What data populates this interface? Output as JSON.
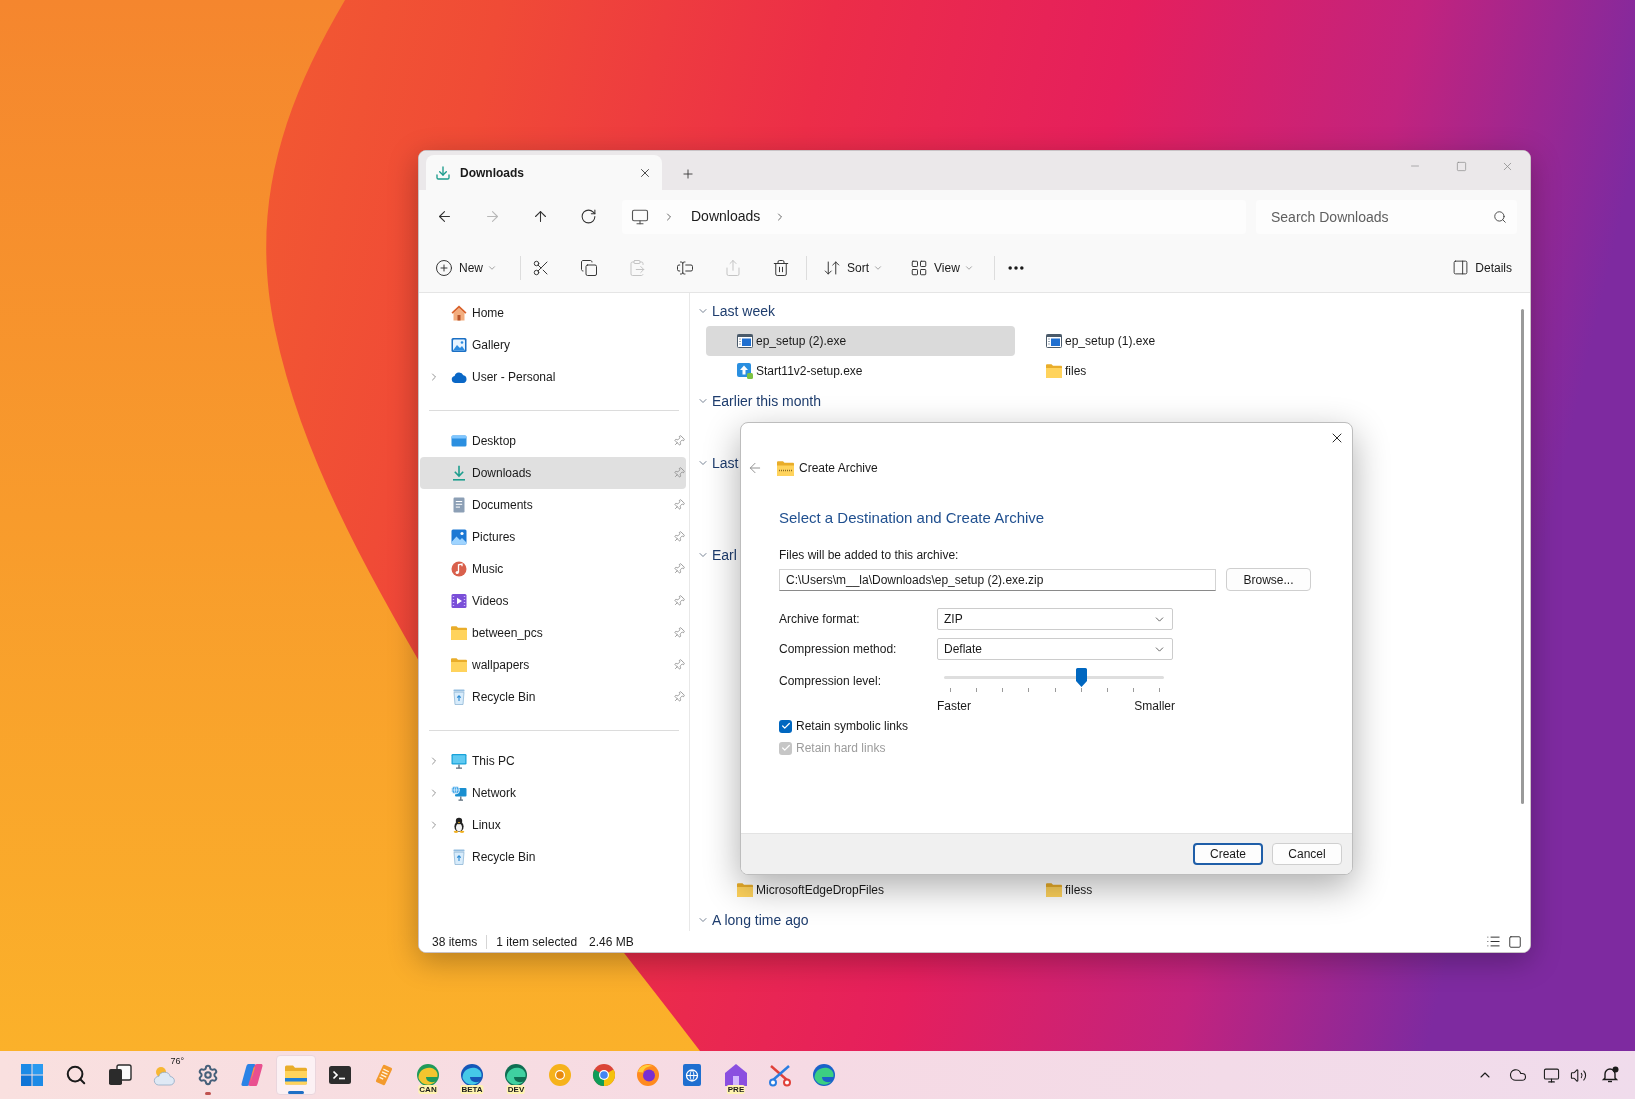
{
  "window": {
    "tabs": [
      {
        "label": "Downloads",
        "selected": true
      }
    ]
  },
  "navigation": {
    "buttons": [
      {
        "disabled": false
      },
      {
        "disabled": true
      },
      {
        "disabled": false
      },
      {
        "disabled": false
      }
    ],
    "path": [
      "Downloads"
    ],
    "search": {
      "placeholder": "Search Downloads"
    }
  },
  "toolbar": {
    "new": {
      "label": "New"
    },
    "actions": [
      {
        "disabled": false
      },
      {
        "disabled": false
      },
      {
        "disabled": true
      },
      {
        "disabled": false
      },
      {
        "disabled": true
      },
      {
        "disabled": false
      }
    ],
    "sort": {
      "label": "Sort"
    },
    "view": {
      "label": "View"
    },
    "details": {
      "label": "Details"
    }
  },
  "sidebar": {
    "groups": [
      {
        "items": [
          {
            "kind": "home",
            "label": "Home",
            "expandable": false,
            "pinned": false,
            "selected": false
          },
          {
            "kind": "gallery",
            "label": "Gallery",
            "expandable": false,
            "pinned": false,
            "selected": false
          },
          {
            "kind": "cloud",
            "label": "User - Personal",
            "expandable": true,
            "pinned": false,
            "selected": false
          }
        ]
      },
      {
        "items": [
          {
            "kind": "desktop",
            "label": "Desktop",
            "expandable": false,
            "pinned": true,
            "selected": false
          },
          {
            "kind": "downloads",
            "label": "Downloads",
            "expandable": false,
            "pinned": true,
            "selected": true
          },
          {
            "kind": "documents",
            "label": "Documents",
            "expandable": false,
            "pinned": true,
            "selected": false
          },
          {
            "kind": "pictures",
            "label": "Pictures",
            "expandable": false,
            "pinned": true,
            "selected": false
          },
          {
            "kind": "music",
            "label": "Music",
            "expandable": false,
            "pinned": true,
            "selected": false
          },
          {
            "kind": "videos",
            "label": "Videos",
            "expandable": false,
            "pinned": true,
            "selected": false
          },
          {
            "kind": "folder",
            "label": "between_pcs",
            "expandable": false,
            "pinned": true,
            "selected": false
          },
          {
            "kind": "folder",
            "label": "wallpapers",
            "expandable": false,
            "pinned": true,
            "selected": false
          },
          {
            "kind": "recycle",
            "label": "Recycle Bin",
            "expandable": false,
            "pinned": true,
            "selected": false
          }
        ]
      },
      {
        "items": [
          {
            "kind": "pc",
            "label": "This PC",
            "expandable": true,
            "pinned": false,
            "selected": false
          },
          {
            "kind": "network",
            "label": "Network",
            "expandable": true,
            "pinned": false,
            "selected": false
          },
          {
            "kind": "linux",
            "label": "Linux",
            "expandable": true,
            "pinned": false,
            "selected": false
          },
          {
            "kind": "recycle",
            "label": "Recycle Bin",
            "expandable": false,
            "pinned": false,
            "selected": false
          }
        ]
      }
    ]
  },
  "content": {
    "groups": [
      {
        "title": "Last week",
        "expanded": true,
        "files": [
          {
            "kind": "program",
            "name": "ep_setup (2).exe",
            "selected": true
          },
          {
            "kind": "program",
            "name": "ep_setup (1).exe",
            "selected": false
          },
          {
            "kind": "installer",
            "name": "Start11v2-setup.exe",
            "selected": false
          },
          {
            "kind": "folder",
            "name": "files",
            "selected": false
          }
        ]
      },
      {
        "title": "Earlier this month",
        "expanded": true
      },
      {
        "title": "Last",
        "expanded": true
      },
      {
        "title": "Earl",
        "expanded": true,
        "files": [
          {
            "kind": "folder",
            "name": "MicrosoftEdgeDropFiles",
            "selected": false
          },
          {
            "kind": "folder",
            "name": "filess",
            "selected": false
          }
        ]
      },
      {
        "title": "A long time ago",
        "expanded": true
      }
    ]
  },
  "status_bar": {
    "count": "38 items",
    "selection": "1 item selected",
    "size": "2.46 MB"
  },
  "dialog": {
    "title": "Create Archive",
    "heading": "Select a Destination and Create Archive",
    "path_label": "Files will be added to this archive:",
    "path": "C:\\Users\\m__la\\Downloads\\ep_setup (2).exe.zip",
    "browse": "Browse...",
    "selects": [
      {
        "label": "Archive format:",
        "value": "ZIP"
      },
      {
        "label": "Compression method:",
        "value": "Deflate"
      }
    ],
    "slider": {
      "label": "Compression level:",
      "level": 0.625,
      "min_label": "Faster",
      "max_label": "Smaller"
    },
    "options": [
      {
        "label": "Retain symbolic links",
        "checked": true,
        "disabled": false
      },
      {
        "label": "Retain hard links",
        "checked": true,
        "disabled": true
      }
    ],
    "buttons": [
      {
        "label": "Create",
        "default": true
      },
      {
        "label": "Cancel",
        "default": false
      }
    ]
  },
  "taskbar": {
    "apps": [
      {
        "kind": "start",
        "running": false,
        "selected": false
      },
      {
        "kind": "search",
        "running": false,
        "selected": false
      },
      {
        "kind": "taskview",
        "running": false,
        "selected": false
      },
      {
        "kind": "weather",
        "badge": "76°",
        "running": false,
        "selected": false
      },
      {
        "kind": "settings",
        "running": true,
        "selected": false
      },
      {
        "kind": "copilot",
        "running": false,
        "selected": false
      },
      {
        "kind": "explorer",
        "running": true,
        "selected": true
      },
      {
        "kind": "terminal",
        "running": false,
        "selected": false
      },
      {
        "kind": "notes",
        "running": false,
        "selected": false
      },
      {
        "kind": "edgecan",
        "badge": "CAN",
        "running": false,
        "selected": false
      },
      {
        "kind": "edgebeta",
        "badge": "BETA",
        "running": false,
        "selected": false
      },
      {
        "kind": "edgedev",
        "badge": "DEV",
        "running": false,
        "selected": false
      },
      {
        "kind": "chromecanary",
        "running": false,
        "selected": false
      },
      {
        "kind": "chrome",
        "running": false,
        "selected": false
      },
      {
        "kind": "firefox",
        "running": false,
        "selected": false
      },
      {
        "kind": "webdoc",
        "running": false,
        "selected": false
      },
      {
        "kind": "pcmanager",
        "badge": "PRE",
        "running": false,
        "selected": false
      },
      {
        "kind": "snip",
        "running": false,
        "selected": false
      },
      {
        "kind": "edge",
        "running": false,
        "selected": false
      }
    ]
  }
}
